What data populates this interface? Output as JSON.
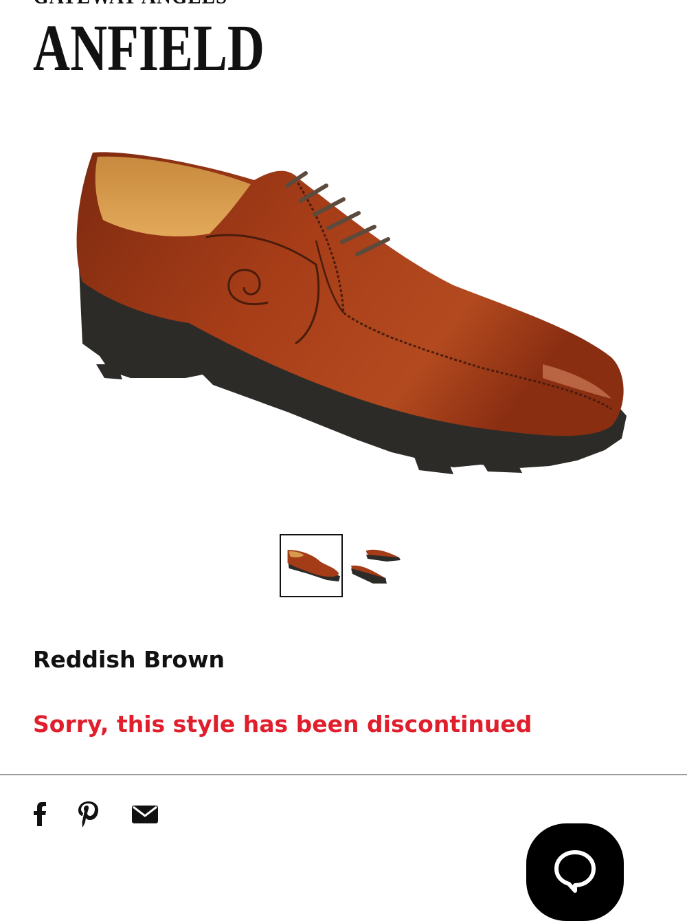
{
  "product": {
    "brand": "GATEWAY ANGELS",
    "name": "ANFIELD",
    "color_name": "Reddish Brown",
    "status_message": "Sorry, this style has been discontinued"
  },
  "gallery": {
    "main_image": "brown-leather-derby-shoe",
    "thumbnails": [
      {
        "name": "thumbnail-single-shoe",
        "selected": true
      },
      {
        "name": "thumbnail-shoe-pair",
        "selected": false
      }
    ]
  },
  "share": {
    "icons": [
      "facebook-icon",
      "pinterest-icon",
      "email-icon"
    ]
  },
  "chat": {
    "icon": "chat-bubble-icon"
  },
  "colors": {
    "discontinued_text": "#e01e2c",
    "leather": "#9e3514",
    "sole": "#2d2b28",
    "chat_button": "#000000"
  }
}
